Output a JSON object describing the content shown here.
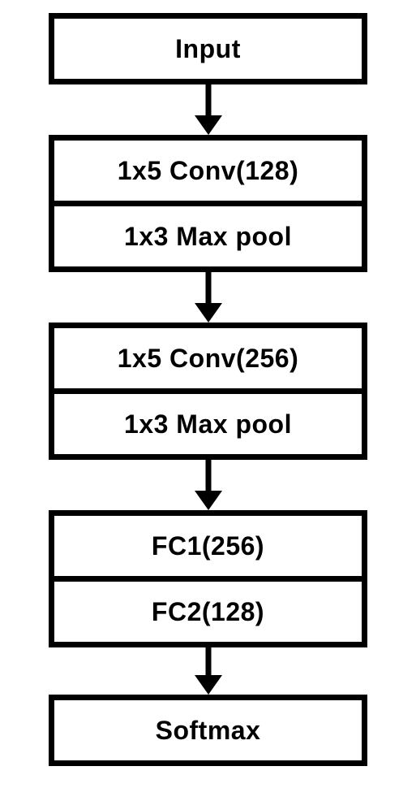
{
  "diagram": {
    "type": "flowchart",
    "layers": [
      {
        "id": "input",
        "cells": [
          "Input"
        ]
      },
      {
        "id": "block1",
        "cells": [
          "1x5 Conv(128)",
          "1x3 Max pool"
        ]
      },
      {
        "id": "block2",
        "cells": [
          "1x5 Conv(256)",
          "1x3 Max pool"
        ]
      },
      {
        "id": "fc",
        "cells": [
          "FC1(256)",
          "FC2(128)"
        ]
      },
      {
        "id": "softmax",
        "cells": [
          "Softmax"
        ]
      }
    ]
  }
}
